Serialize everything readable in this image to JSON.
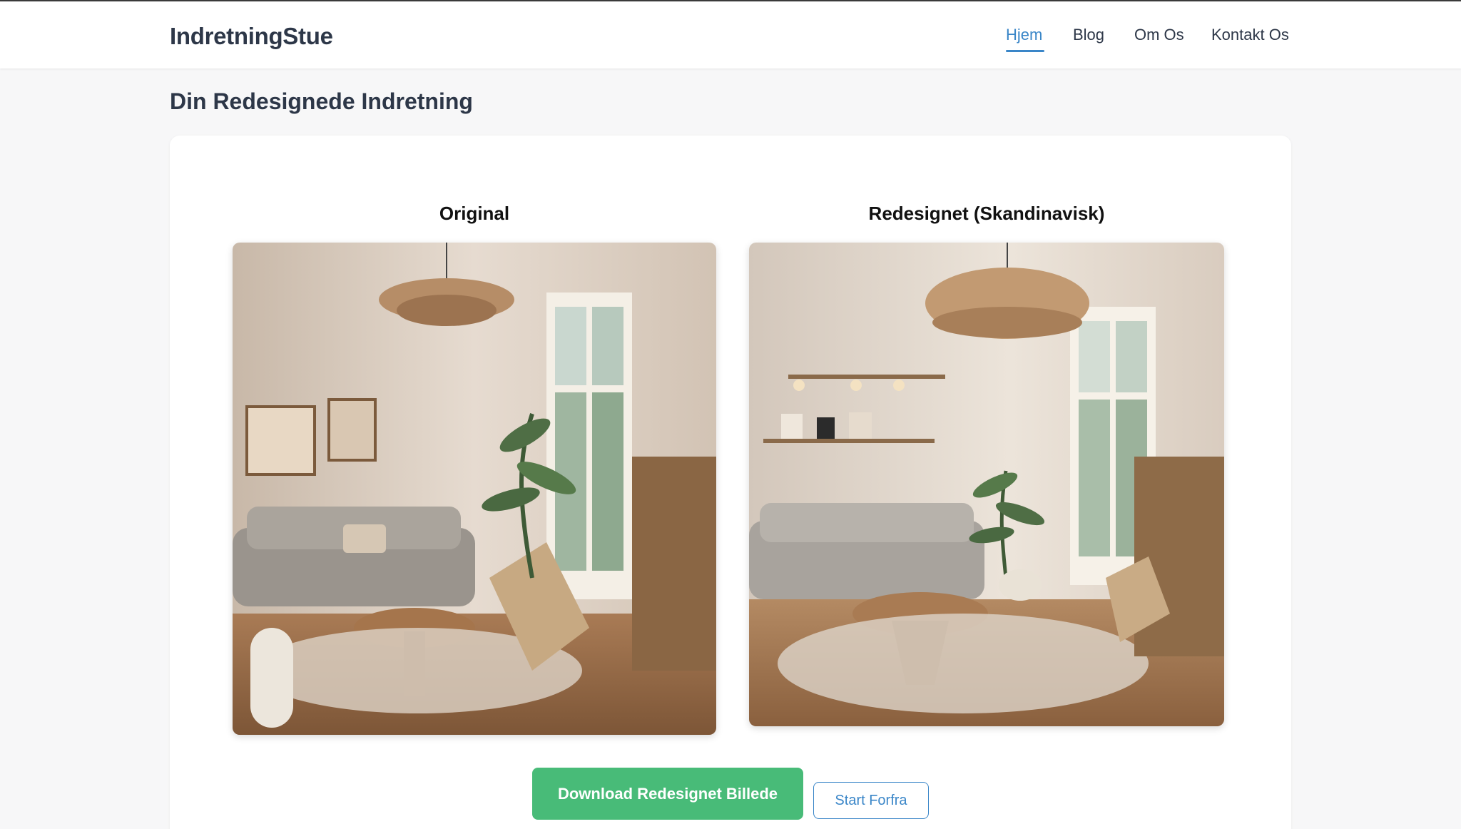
{
  "header": {
    "brand": "IndretningStue",
    "nav": [
      {
        "label": "Hjem",
        "active": true
      },
      {
        "label": "Blog",
        "active": false
      },
      {
        "label": "Om Os",
        "active": false
      },
      {
        "label": "Kontakt Os",
        "active": false
      }
    ]
  },
  "main": {
    "title": "Din Redesignede Indretning",
    "original": {
      "title": "Original",
      "image": "living-room-original-photo"
    },
    "redesigned": {
      "title": "Redesignet (Skandinavisk)",
      "image": "living-room-redesigned-photo"
    },
    "buttons": {
      "download": "Download Redesignet Billede",
      "restart": "Start Forfra"
    }
  },
  "colors": {
    "accent": "#3a86c8",
    "primary_button": "#48bb78",
    "background": "#f7f7f8",
    "text": "#2d3748"
  }
}
